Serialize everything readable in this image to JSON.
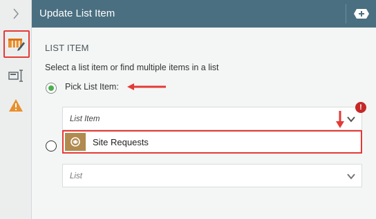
{
  "header": {
    "title": "Update List Item"
  },
  "rail": {
    "icons": [
      "expand-chevron-icon",
      "list-edit-icon",
      "text-input-icon",
      "warning-icon"
    ]
  },
  "main": {
    "section_title": "LIST ITEM",
    "description": "Select a list item or find multiple items in a list",
    "option_pick_label": "Pick List Item:",
    "list_item_field_label": "List Item",
    "selected_item": "Site Requests",
    "list_field_label": "List",
    "error_badge": "!"
  },
  "colors": {
    "header_bg": "#4a6f80",
    "highlight": "#e53935",
    "radio_selected": "#4caf50",
    "list_icon_bg": "#b08a4e",
    "error": "#c62828",
    "warning": "#e8902e"
  }
}
